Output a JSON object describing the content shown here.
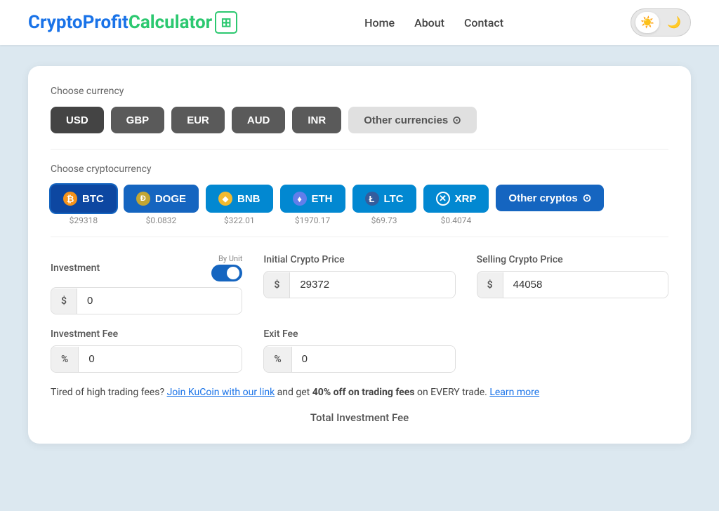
{
  "header": {
    "logo": {
      "part1": "Crypto",
      "part2": "Profit",
      "part3": "Calculator"
    },
    "nav": {
      "home": "Home",
      "about": "About",
      "contact": "Contact"
    },
    "theme": {
      "light_icon": "☀️",
      "dark_icon": "🌙"
    }
  },
  "currency_section": {
    "label": "Choose currency",
    "buttons": [
      {
        "id": "usd",
        "label": "USD",
        "active": true
      },
      {
        "id": "gbp",
        "label": "GBP",
        "active": false
      },
      {
        "id": "eur",
        "label": "EUR",
        "active": false
      },
      {
        "id": "aud",
        "label": "AUD",
        "active": false
      },
      {
        "id": "inr",
        "label": "INR",
        "active": false
      },
      {
        "id": "other",
        "label": "Other currencies",
        "active": false,
        "other": true
      }
    ]
  },
  "crypto_section": {
    "label": "Choose cryptocurrency",
    "cryptos": [
      {
        "id": "btc",
        "label": "BTC",
        "price": "$29318",
        "icon_text": "₿",
        "icon_class": "btc-icon",
        "selected": true
      },
      {
        "id": "doge",
        "label": "DOGE",
        "price": "$0.0832",
        "icon_text": "Ð",
        "icon_class": "doge-icon",
        "selected": false
      },
      {
        "id": "bnb",
        "label": "BNB",
        "price": "$322.01",
        "icon_text": "◆",
        "icon_class": "bnb-icon",
        "selected": false
      },
      {
        "id": "eth",
        "label": "ETH",
        "price": "$1970.17",
        "icon_text": "⬨",
        "icon_class": "eth-icon",
        "selected": false
      },
      {
        "id": "ltc",
        "label": "LTC",
        "price": "$69.73",
        "icon_text": "Ł",
        "icon_class": "ltc-icon",
        "selected": false
      },
      {
        "id": "xrp",
        "label": "XRP",
        "price": "$0.4074",
        "icon_text": "✕",
        "icon_class": "xrp-icon",
        "selected": false
      },
      {
        "id": "other",
        "label": "Other cryptos",
        "price": "",
        "icon_text": "",
        "icon_class": "",
        "selected": false,
        "other": true
      }
    ]
  },
  "form": {
    "investment": {
      "label": "Investment",
      "by_unit_label": "By Unit",
      "prefix": "$",
      "value": "0",
      "toggle_on": true
    },
    "initial_price": {
      "label": "Initial Crypto Price",
      "prefix": "$",
      "value": "29372"
    },
    "selling_price": {
      "label": "Selling Crypto Price",
      "prefix": "$",
      "value": "44058"
    },
    "investment_fee": {
      "label": "Investment Fee",
      "prefix": "%",
      "value": "0"
    },
    "exit_fee": {
      "label": "Exit Fee",
      "prefix": "%",
      "value": "0"
    }
  },
  "promo": {
    "text1": "Tired of high trading fees?",
    "link1": "Join KuCoin with our link",
    "text2": "and get",
    "bold": "40% off on trading fees",
    "text3": "on EVERY trade.",
    "link2": "Learn more"
  },
  "total_label": "Total Investment Fee"
}
